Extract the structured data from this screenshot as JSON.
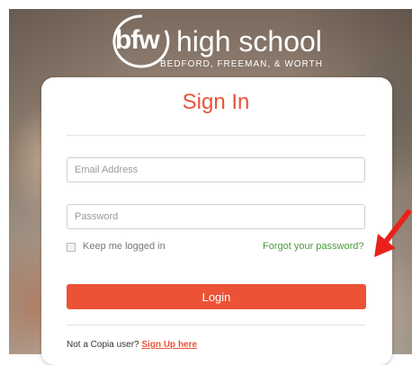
{
  "brand": {
    "logo_mark": "bfw",
    "logo_name": "high school",
    "logo_tagline": "BEDFORD, FREEMAN, & WORTH"
  },
  "signin": {
    "title": "Sign In",
    "email_placeholder": "Email Address",
    "email_value": "",
    "password_placeholder": "Password",
    "password_value": "",
    "keep_logged_in_label": "Keep me logged in",
    "keep_logged_in_checked": false,
    "forgot_password_label": "Forgot your password?",
    "login_button_label": "Login",
    "not_user_text": "Not a Copia user?",
    "signup_link_label": "Sign Up here"
  },
  "annotation": {
    "arrow_icon": "red-arrow-icon",
    "arrow_color": "#e8221b"
  },
  "colors": {
    "accent": "#ec5236",
    "link_green": "#4a9b3c"
  }
}
